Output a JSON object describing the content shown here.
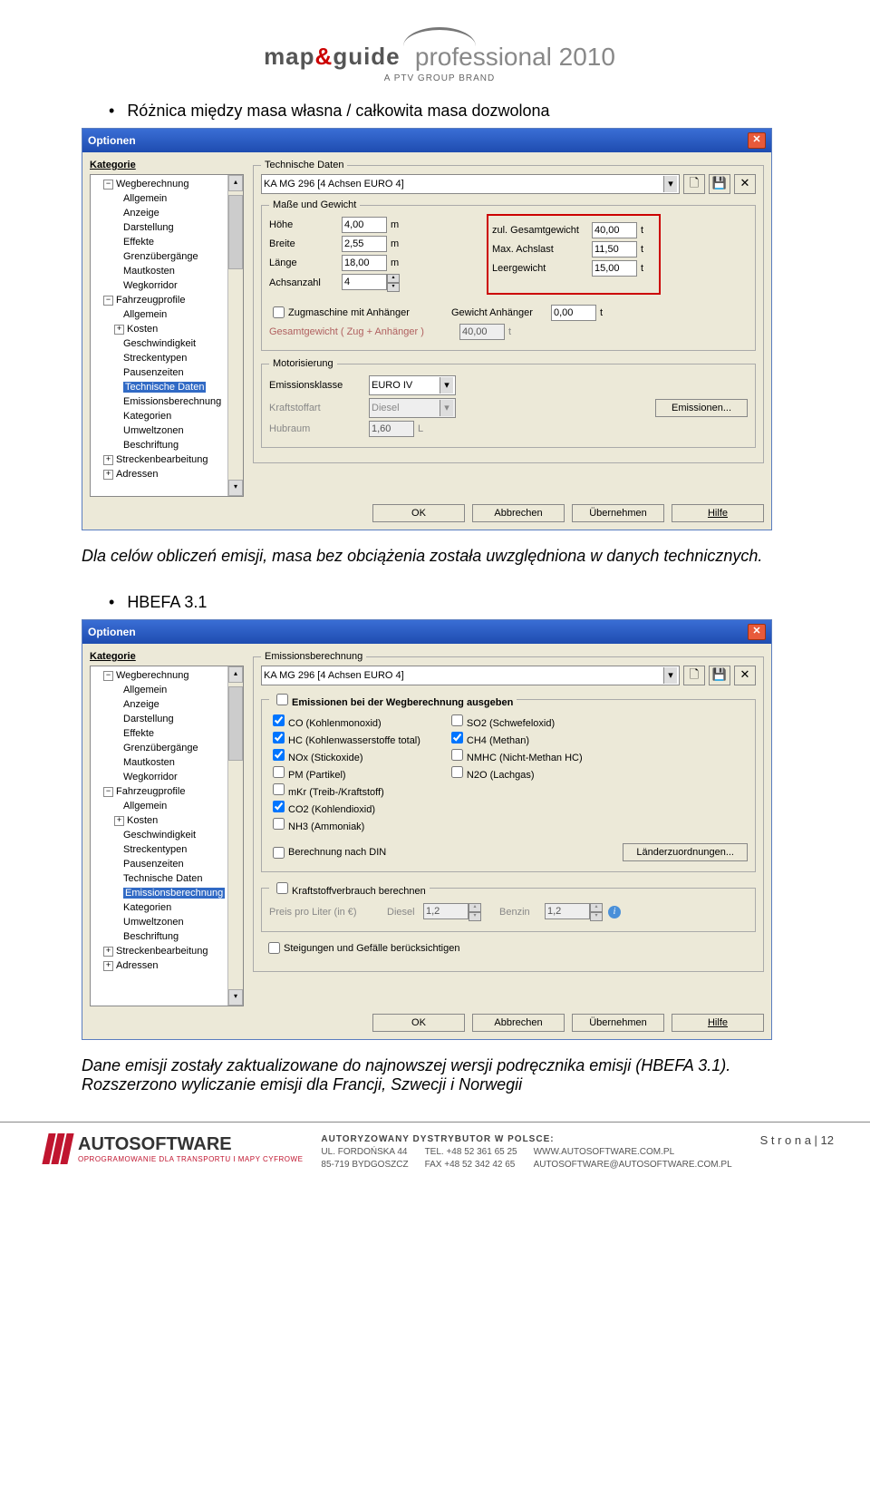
{
  "header": {
    "logo_map": "map",
    "logo_amp": "&",
    "logo_guide": "guide",
    "logo_prof": "professional 2010",
    "logo_sub": "A PTV GROUP BRAND"
  },
  "section1": {
    "bullet": "Różnica między masa własna / całkowita masa dozwolona",
    "after_text": "Dla celów obliczeń emisji, masa bez obciążenia została uwzględniona w danych technicznych."
  },
  "section2": {
    "bullet": "HBEFA 3.1",
    "after_text": "Dane emisji zostały zaktualizowane do najnowszej wersji podręcznika emisji  (HBEFA 3.1). Rozszerzono wyliczanie emisji dla Francji, Szwecji i Norwegii"
  },
  "win_title": "Optionen",
  "tree_heading": "Kategorie",
  "tree": {
    "root1": "Wegberechnung",
    "items1": [
      "Allgemein",
      "Anzeige",
      "Darstellung",
      "Effekte",
      "Grenzübergänge",
      "Mautkosten",
      "Wegkorridor"
    ],
    "root2": "Fahrzeugprofile",
    "items2a": [
      "Allgemein",
      "Kosten",
      "Geschwindigkeit",
      "Streckentypen",
      "Pausenzeiten"
    ],
    "tech": "Technische Daten",
    "emis": "Emissionsberechnung",
    "items2b": [
      "Kategorien",
      "Umweltzonen",
      "Beschriftung"
    ],
    "root3": "Streckenbearbeitung",
    "root4": "Adressen"
  },
  "dlg1": {
    "legend_tech": "Technische Daten",
    "vehicle": "KA MG 296 [4 Achsen EURO 4]",
    "legend_mg": "Maße und Gewicht",
    "hohe_l": "Höhe",
    "hohe_v": "4,00",
    "breite_l": "Breite",
    "breite_v": "2,55",
    "lange_l": "Länge",
    "lange_v": "18,00",
    "achs_l": "Achsanzahl",
    "achs_v": "4",
    "zul_l": "zul. Gesamtgewicht",
    "zul_v": "40,00",
    "max_l": "Max. Achslast",
    "max_v": "11,50",
    "leer_l": "Leergewicht",
    "leer_v": "15,00",
    "m": "m",
    "t": "t",
    "zug_chk": "Zugmaschine mit Anhänger",
    "gew_anh_l": "Gewicht Anhänger",
    "gew_anh_v": "0,00",
    "gesamt_l": "Gesamtgewicht ( Zug + Anhänger )",
    "gesamt_v": "40,00",
    "legend_mot": "Motorisierung",
    "ekl_l": "Emissionsklasse",
    "ekl_v": "EURO IV",
    "kraft_l": "Kraftstoffart",
    "kraft_v": "Diesel",
    "hub_l": "Hubraum",
    "hub_v": "1,60",
    "L": "L",
    "emis_btn": "Emissionen..."
  },
  "dlg2": {
    "legend_emis": "Emissionsberechnung",
    "chk_main": "Emissionen bei der Wegberechnung ausgeben",
    "co": "CO (Kohlenmonoxid)",
    "so2": "SO2 (Schwefeloxid)",
    "hc": "HC (Kohlenwasserstoffe total)",
    "ch4": "CH4 (Methan)",
    "nox": "NOx (Stickoxide)",
    "nmhc": "NMHC (Nicht-Methan HC)",
    "pm": "PM (Partikel)",
    "n2o": "N2O (Lachgas)",
    "mkr": "mKr (Treib-/Kraftstoff)",
    "co2": "CO2 (Kohlendioxid)",
    "nh3": "NH3 (Ammoniak)",
    "din": "Berechnung nach DIN",
    "lander_btn": "Länderzuordnungen...",
    "kraftver": "Kraftstoffverbrauch berechnen",
    "preis_l": "Preis pro Liter (in €)",
    "diesel_l": "Diesel",
    "diesel_v": "1,2",
    "benzin_l": "Benzin",
    "benzin_v": "1,2",
    "steig": "Steigungen und Gefälle berücksichtigen"
  },
  "buttons": {
    "ok": "OK",
    "cancel": "Abbrechen",
    "apply": "Übernehmen",
    "help": "Hilfe"
  },
  "footer": {
    "brand": "AUTOSOFTWARE",
    "brand_sub": "OPROGRAMOWANIE DLA TRANSPORTU I MAPY CYFROWE",
    "hd": "AUTORYZOWANY DYSTRYBUTOR W POLSCE:",
    "l1": "UL. FORDOŃSKA 44",
    "l2": "85-719 BYDGOSZCZ",
    "t1": "TEL. +48 52 361 65 25",
    "t2": "FAX  +48 52 342 42 65",
    "w1": "WWW.AUTOSOFTWARE.COM.PL",
    "w2": "AUTOSOFTWARE@AUTOSOFTWARE.COM.PL",
    "page": "S t r o n a | 12"
  }
}
